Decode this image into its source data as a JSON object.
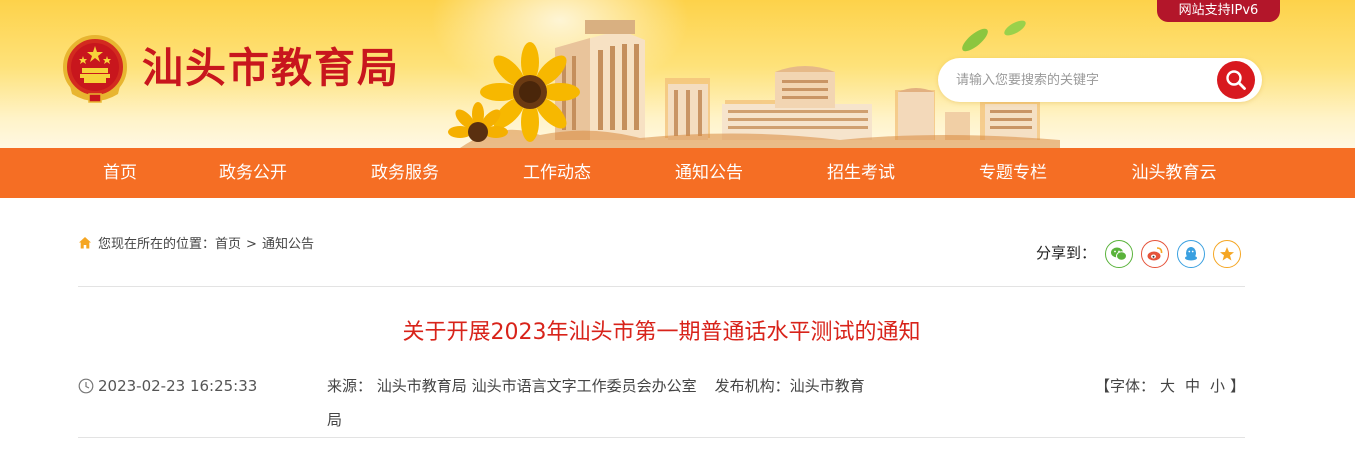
{
  "header": {
    "site_title": "汕头市教育局",
    "ipv6_badge": "网站支持IPv6",
    "search_placeholder": "请输入您要搜索的关键字"
  },
  "nav": {
    "items": [
      "首页",
      "政务公开",
      "政务服务",
      "工作动态",
      "通知公告",
      "招生考试",
      "专题专栏",
      "汕头教育云"
    ]
  },
  "breadcrumb": {
    "prefix": "您现在所在的位置：",
    "home": "首页",
    "separator": ">",
    "current": "通知公告"
  },
  "share": {
    "label": "分享到：",
    "icons": [
      "wechat-icon",
      "weibo-icon",
      "qq-icon",
      "favorite-star-icon"
    ]
  },
  "article": {
    "title": "关于开展2023年汕头市第一期普通话水平测试的通知",
    "datetime": "2023-02-23 16:25:33",
    "source_label": "来源：",
    "source": "汕头市教育局 汕头市语言文字工作委员会办公室",
    "publisher_label": "发布机构：",
    "publisher": "汕头市教育局",
    "font_label_open": "【字体：",
    "font_large": "大",
    "font_medium": "中",
    "font_small": "小",
    "font_label_close": "】"
  },
  "colors": {
    "brand_red": "#c8161d",
    "nav_orange": "#f56e24",
    "title_red": "#d8231a",
    "badge_red": "#b3162a",
    "wechat_green": "#5ab33b",
    "weibo_red": "#e5533a",
    "qq_blue": "#3aa0e0",
    "star_orange": "#f5a623"
  }
}
